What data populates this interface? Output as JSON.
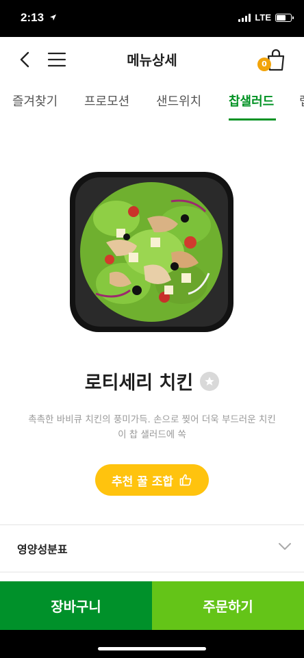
{
  "status_bar": {
    "time": "2:13",
    "network": "LTE"
  },
  "header": {
    "title": "메뉴상세",
    "cart_count": "0"
  },
  "tabs": [
    {
      "label": "즐겨찾기"
    },
    {
      "label": "프로모션"
    },
    {
      "label": "샌드위치"
    },
    {
      "label": "찹샐러드"
    },
    {
      "label": "랩"
    }
  ],
  "active_tab_index": 3,
  "product": {
    "name": "로티세리 치킨",
    "description_line1": "촉촉한 바비큐 치킨의 풍미가득. 손으로 찢어 더욱 부드러운 치킨",
    "description_line2": "이 찹 샐러드에 쏙",
    "recommend_label": "추천 꿀 조합"
  },
  "nutrition": {
    "label": "영양성분표"
  },
  "bottom_bar": {
    "cart_label": "장바구니",
    "order_label": "주문하기"
  },
  "colors": {
    "brand_green": "#009223",
    "order_green": "#64c418",
    "accent_yellow": "#ffc30e",
    "badge_orange": "#f2a40a"
  }
}
